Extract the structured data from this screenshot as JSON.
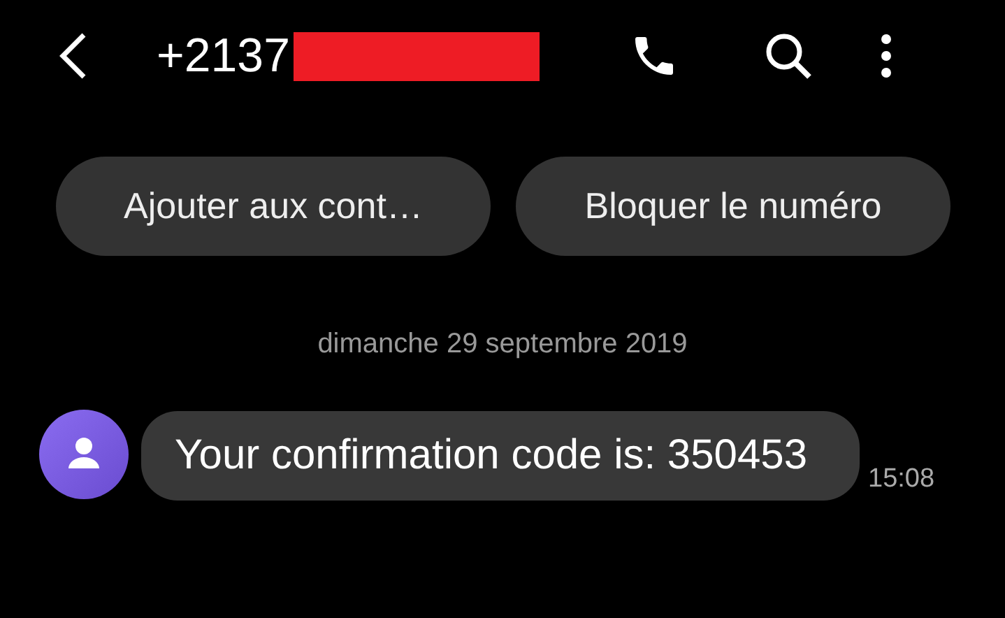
{
  "header": {
    "title": "+2137"
  },
  "actions": [
    {
      "label": "Ajouter aux cont…"
    },
    {
      "label": "Bloquer le numéro"
    }
  ],
  "date": "dimanche 29 septembre 2019",
  "messages": [
    {
      "text": "Your confirmation code is: 350453",
      "time": "15:08"
    }
  ]
}
